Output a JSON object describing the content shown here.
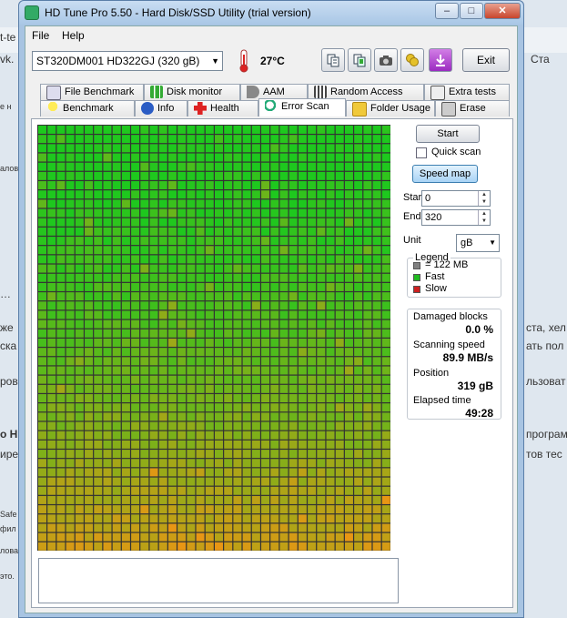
{
  "background": {
    "lines": [
      "t-te",
      "vk.",
      "е н",
      "алов",
      "…",
      "же",
      "ска",
      "ров",
      "о HD",
      "ире",
      "Safe",
      "фил",
      "лова",
      "это."
    ],
    "right_lines": [
      "Ста",
      "ста, хел",
      "ать пол",
      "льзоват",
      "програм",
      "тов тес"
    ]
  },
  "window": {
    "title": "HD Tune Pro 5.50 - Hard Disk/SSD Utility (trial version)",
    "caption_buttons": [
      "–",
      "□",
      "✕"
    ]
  },
  "menu": {
    "file": "File",
    "help": "Help"
  },
  "toolbar": {
    "drive": "ST320DM001 HD322GJ (320 gB)",
    "temperature": "27°C",
    "exit_label": "Exit",
    "tools": [
      "copy-info-icon",
      "copy-screenshot-icon",
      "camera-icon",
      "coins-icon",
      "save-down-icon"
    ]
  },
  "tabs_top": [
    {
      "label": "File Benchmark",
      "icon": "file-benchmark-icon"
    },
    {
      "label": "Disk monitor",
      "icon": "disk-monitor-icon"
    },
    {
      "label": "AAM",
      "icon": "speaker-icon"
    },
    {
      "label": "Random Access",
      "icon": "random-access-icon"
    },
    {
      "label": "Extra tests",
      "icon": "extra-tests-icon"
    }
  ],
  "tabs_bottom": [
    {
      "label": "Benchmark",
      "icon": "benchmark-icon"
    },
    {
      "label": "Info",
      "icon": "info-icon"
    },
    {
      "label": "Health",
      "icon": "health-icon"
    },
    {
      "label": "Error Scan",
      "icon": "error-scan-icon",
      "active": true
    },
    {
      "label": "Folder Usage",
      "icon": "folder-icon"
    },
    {
      "label": "Erase",
      "icon": "erase-icon"
    }
  ],
  "controls": {
    "start_label": "Start",
    "quick_scan_label": "Quick scan",
    "quick_scan_checked": false,
    "speed_map_label": "Speed map",
    "start_field_label": "Start",
    "start_value": "0",
    "end_field_label": "End",
    "end_value": "320",
    "unit_label": "Unit",
    "unit_value": "gB"
  },
  "legend": {
    "title": "Legend",
    "items": [
      {
        "label": "= 122 MB",
        "color": "#808080"
      },
      {
        "label": "Fast",
        "color": "#22bb22"
      },
      {
        "label": "Slow",
        "color": "#cc2020"
      }
    ]
  },
  "stats": {
    "damaged_label": "Damaged blocks",
    "damaged_value": "0.0 %",
    "speed_label": "Scanning speed",
    "speed_value": "89.9 MB/s",
    "position_label": "Position",
    "position_value": "319 gB",
    "elapsed_label": "Elapsed time",
    "elapsed_value": "49:28"
  },
  "scan_map": {
    "columns": 38,
    "rows": 46,
    "colors": {
      "fast": "#1ec81e",
      "slow": "#e84010"
    }
  }
}
